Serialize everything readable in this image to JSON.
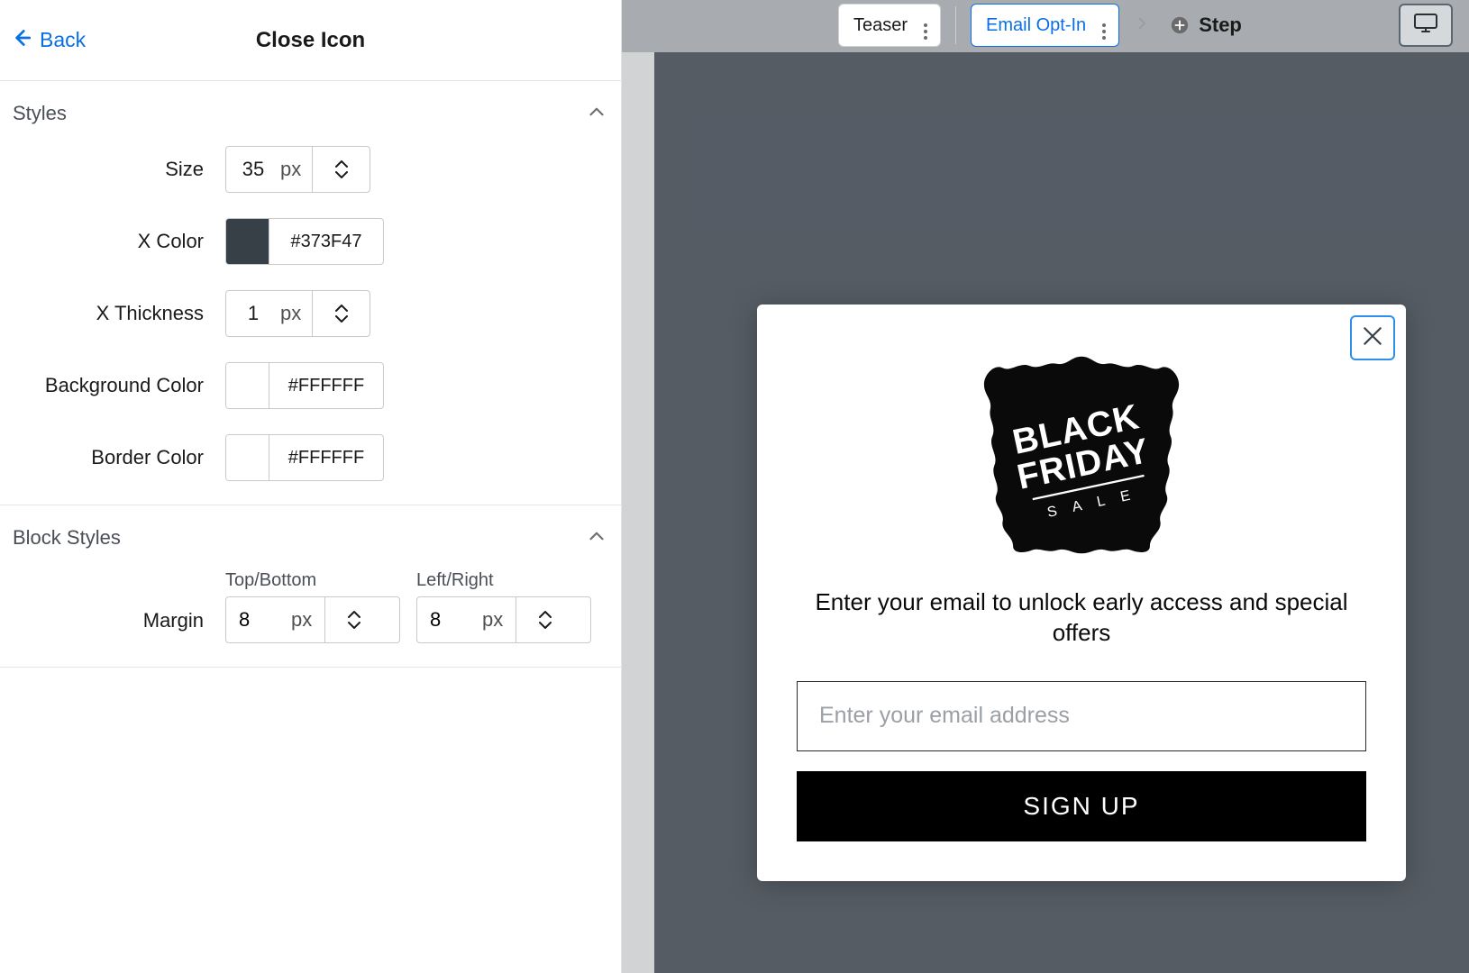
{
  "sidebar": {
    "back_label": "Back",
    "title": "Close Icon",
    "sections": {
      "styles": {
        "title": "Styles",
        "size": {
          "label": "Size",
          "value": "35",
          "unit": "px"
        },
        "x_color": {
          "label": "X Color",
          "hex": "#373F47",
          "swatch": "#373F47"
        },
        "x_thickness": {
          "label": "X Thickness",
          "value": "1",
          "unit": "px"
        },
        "bg_color": {
          "label": "Background Color",
          "hex": "#FFFFFF",
          "swatch": "#FFFFFF"
        },
        "border_color": {
          "label": "Border Color",
          "hex": "#FFFFFF",
          "swatch": "#FFFFFF"
        }
      },
      "block": {
        "title": "Block Styles",
        "margin_label": "Margin",
        "tb": {
          "label": "Top/Bottom",
          "value": "8",
          "unit": "px"
        },
        "lr": {
          "label": "Left/Right",
          "value": "8",
          "unit": "px"
        }
      }
    }
  },
  "topbar": {
    "teaser": "Teaser",
    "email_opt": "Email Opt-In",
    "step": "Step"
  },
  "popup": {
    "badge_line1": "BLACK",
    "badge_line2": "FRIDAY",
    "badge_sub": "S A L E",
    "desc": "Enter your email to unlock early access and special offers",
    "placeholder": "Enter your email address",
    "button": "SIGN UP"
  }
}
